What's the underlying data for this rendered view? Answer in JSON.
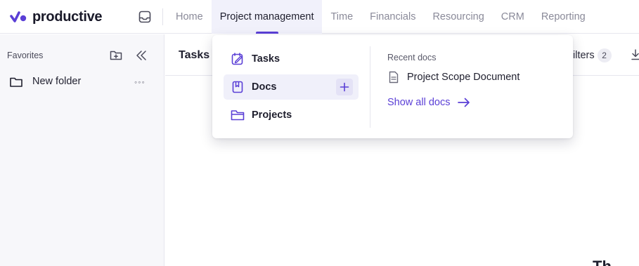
{
  "app": {
    "logo_text": "productive",
    "brand_color": "#5a3fd6"
  },
  "nav": {
    "items": [
      {
        "label": "Home",
        "active": false
      },
      {
        "label": "Project management",
        "active": true
      },
      {
        "label": "Time",
        "active": false
      },
      {
        "label": "Financials",
        "active": false
      },
      {
        "label": "Resourcing",
        "active": false
      },
      {
        "label": "CRM",
        "active": false
      },
      {
        "label": "Reporting",
        "active": false
      }
    ],
    "inbox_icon": "inbox-icon"
  },
  "sidebar": {
    "favorites_label": "Favorites",
    "add_folder_icon": "folder-plus-icon",
    "collapse_icon": "double-chevron-left-icon",
    "folders": [
      {
        "name": "New folder",
        "icon": "folder-icon",
        "more_icon": "more-horizontal-icon"
      }
    ]
  },
  "main": {
    "title": "Tasks",
    "filters_label": "ilters",
    "filters_count": "2",
    "download_icon": "download-icon",
    "corner_glyph": "Th"
  },
  "dropdown": {
    "items": [
      {
        "label": "Tasks",
        "icon": "tasks-icon",
        "hover": false
      },
      {
        "label": "Docs",
        "icon": "docs-icon",
        "hover": true,
        "action_icon": "plus-icon"
      },
      {
        "label": "Projects",
        "icon": "projects-folder-icon",
        "hover": false
      }
    ],
    "recent_label": "Recent docs",
    "recent_docs": [
      {
        "title": "Project Scope Document",
        "icon": "document-icon"
      }
    ],
    "show_all_label": "Show all docs",
    "show_all_icon": "arrow-right-icon"
  }
}
